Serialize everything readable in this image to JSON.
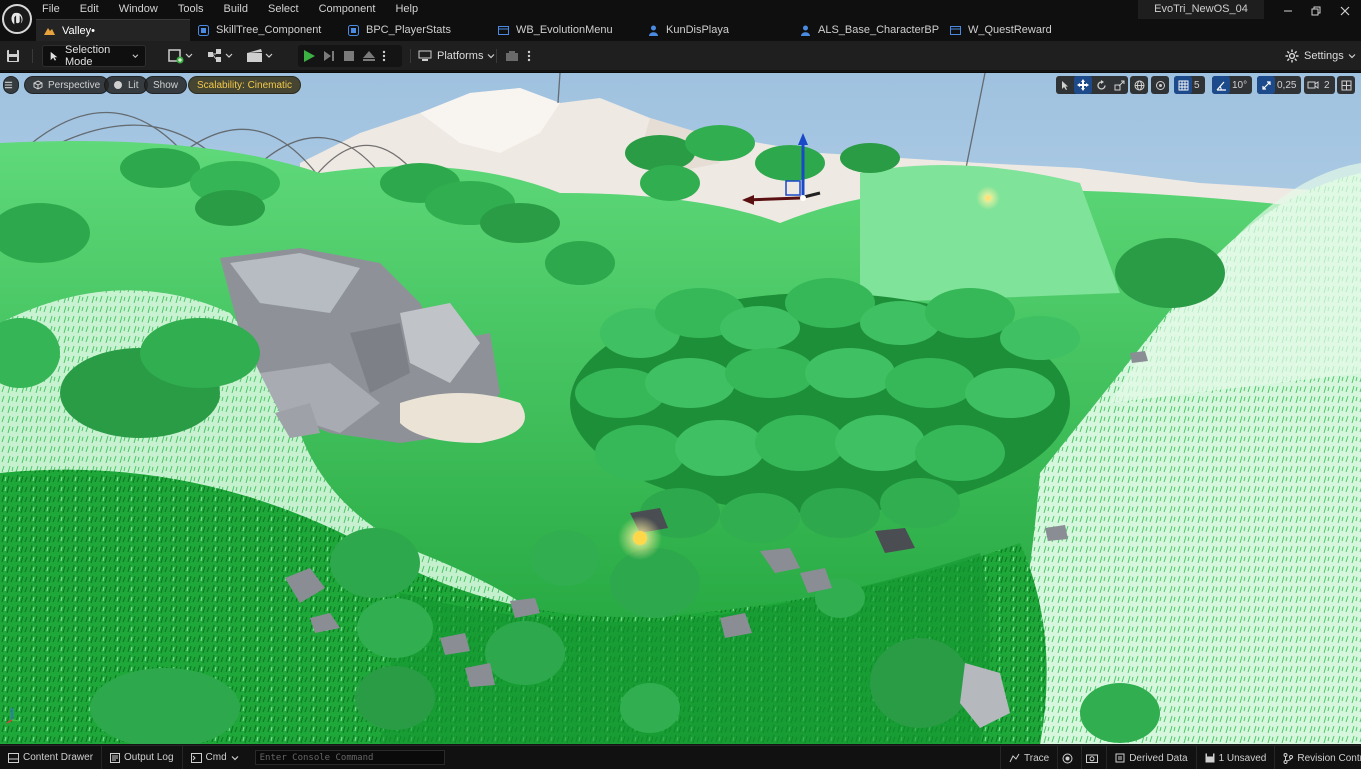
{
  "menu": [
    "File",
    "Edit",
    "Window",
    "Tools",
    "Build",
    "Select",
    "Component",
    "Help"
  ],
  "project_name": "EvoTri_NewOS_04",
  "tabs": [
    {
      "label": "Valley•",
      "icon": "level-icon",
      "active": true
    },
    {
      "label": "SkillTree_Component",
      "icon": "blueprint-icon",
      "active": false
    },
    {
      "label": "BPC_PlayerStats",
      "icon": "blueprint-icon",
      "active": false
    },
    {
      "label": "WB_EvolutionMenu",
      "icon": "widget-icon",
      "active": false
    },
    {
      "label": "KunDisPlaya",
      "icon": "character-icon",
      "active": false
    },
    {
      "label": "ALS_Base_CharacterBP",
      "icon": "character-icon",
      "active": false
    },
    {
      "label": "W_QuestReward",
      "icon": "widget-icon",
      "active": false
    }
  ],
  "toolbar": {
    "mode_label": "Selection Mode",
    "platforms_label": "Platforms",
    "settings_label": "Settings"
  },
  "viewport": {
    "perspective_label": "Perspective",
    "lit_label": "Lit",
    "show_label": "Show",
    "scalability_label": "Scalability: Cinematic",
    "grid_snap": "5",
    "rotation_snap": "10°",
    "scale_snap": "0,25",
    "camera_speed": "2"
  },
  "statusbar": {
    "content_drawer": "Content Drawer",
    "output_log": "Output Log",
    "cmd": "Cmd",
    "console_placeholder": "Enter Console Command",
    "trace": "Trace",
    "derived_data": "Derived Data",
    "unsaved": "1 Unsaved",
    "revision_control": "Revision Control"
  },
  "colors": {
    "accent_blue": "#1d4a8a",
    "play_green": "#3cb043",
    "scalability_yellow": "#f2c94c"
  }
}
